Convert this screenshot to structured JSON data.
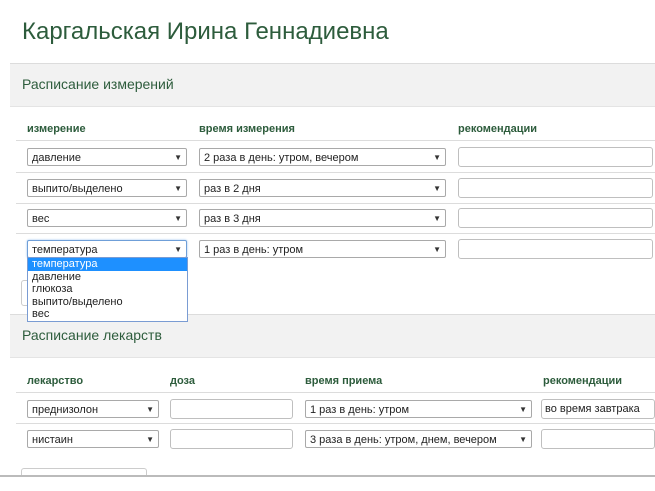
{
  "patient_name": "Каргальская Ирина Геннадиевна",
  "measurements": {
    "title": "Расписание измерений",
    "headers": {
      "measure": "измерение",
      "time": "время измерения",
      "rec": "рекомендации"
    },
    "rows": [
      {
        "measure": "давление",
        "time": "2 раза в день: утром, вечером",
        "rec": ""
      },
      {
        "measure": "выпито/выделено",
        "time": "раз в 2 дня",
        "rec": ""
      },
      {
        "measure": "вес",
        "time": "раз в 3 дня",
        "rec": ""
      },
      {
        "measure": "температура",
        "time": "1 раз в день: утром",
        "rec": ""
      }
    ],
    "dropdown_options": [
      "температура",
      "давление",
      "глюкоза",
      "выпито/выделено",
      "вес"
    ]
  },
  "medications": {
    "title": "Расписание лекарств",
    "headers": {
      "drug": "лекарство",
      "dose": "доза",
      "time": "время приема",
      "rec": "рекомендации"
    },
    "rows": [
      {
        "drug": "преднизолон",
        "dose": "",
        "time": "1 раз в день: утром",
        "rec": "во время завтрака"
      },
      {
        "drug": "нистаин",
        "dose": "",
        "time": "3 раза в день: утром, днем, вечером",
        "rec": ""
      }
    ]
  },
  "icons": {
    "arrow": "▼"
  }
}
